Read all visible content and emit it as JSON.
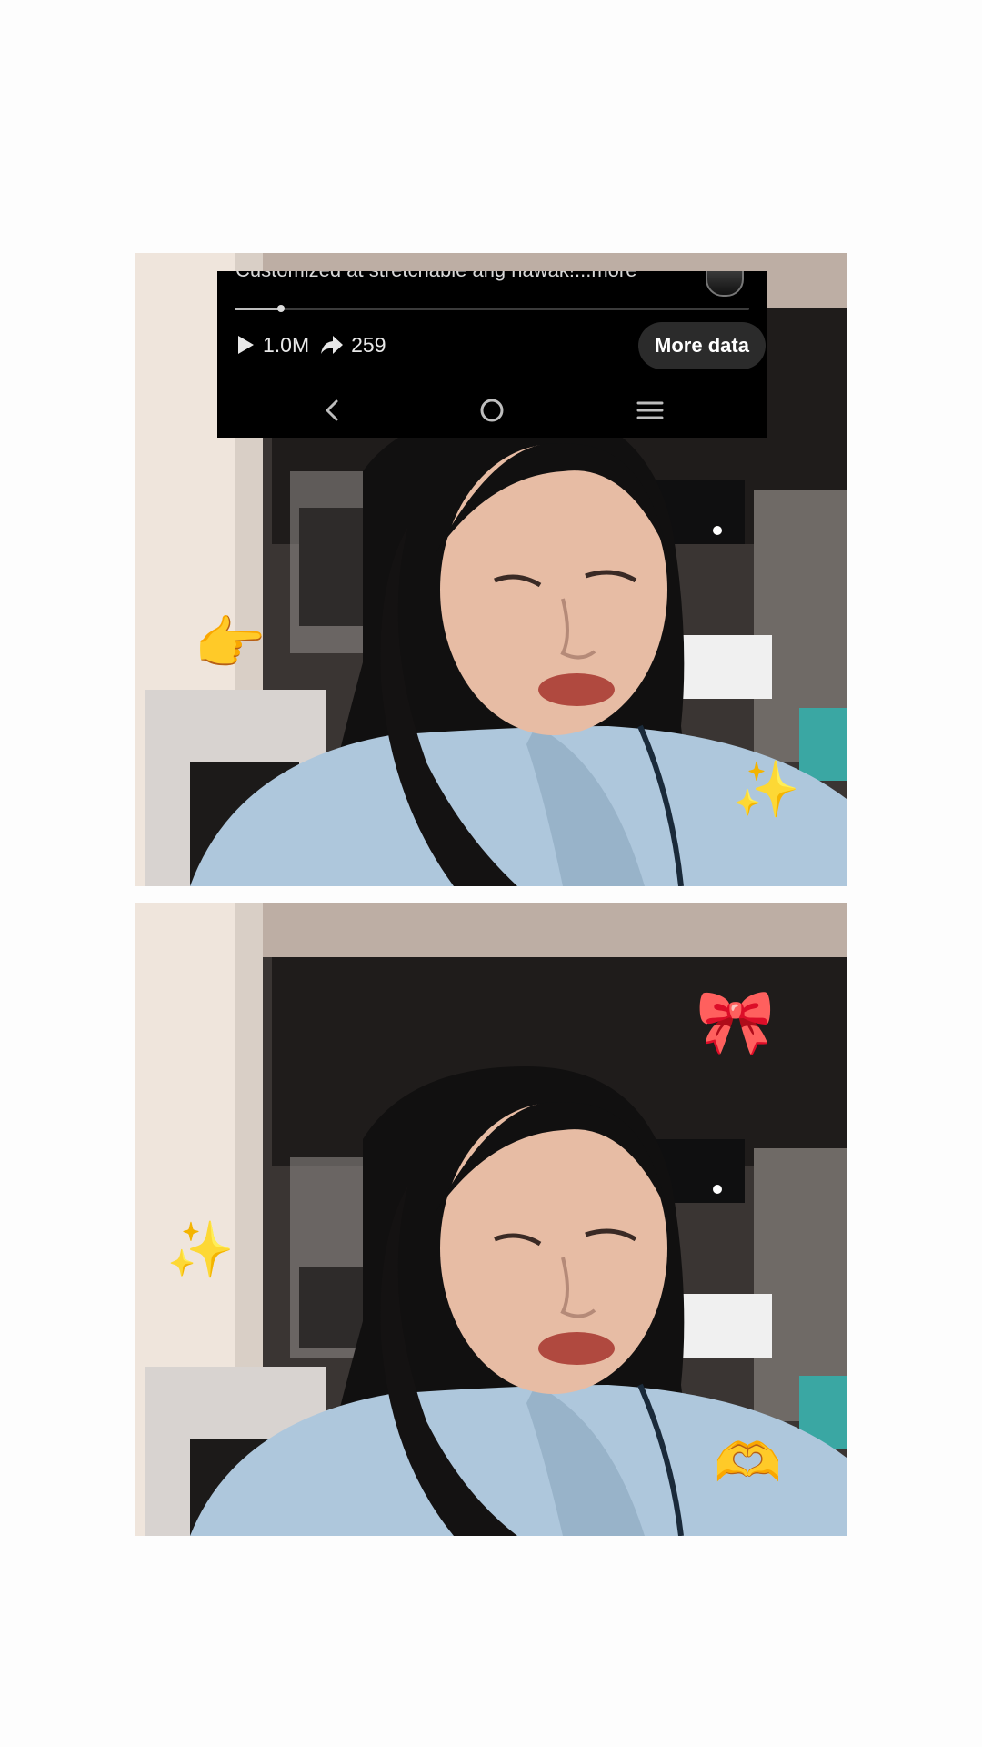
{
  "overlay": {
    "caption_partial": "Customized at stretchable ang hawak!...more",
    "playback_progress": 0.09,
    "views": "1.0M",
    "shares": "259",
    "more_button": "More data"
  },
  "icons": {
    "play": "play-icon",
    "share": "share-arrow-icon",
    "back": "back-chevron-icon",
    "home": "home-circle-icon",
    "recents": "recents-menu-icon"
  },
  "stickers": {
    "top": [
      "sparkles",
      "pointing-hand"
    ],
    "bottom": [
      "ribbon",
      "sparkles",
      "heart-hands"
    ]
  },
  "colors": {
    "overlay_bg": "#000000",
    "button_bg": "#2b2b2b",
    "hoodie": "#aec7dc"
  }
}
